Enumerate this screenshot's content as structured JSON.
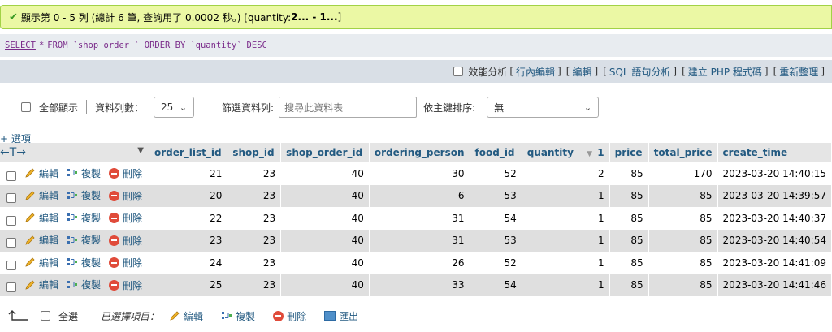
{
  "success": {
    "prefix": "顯示第 0 - 5 列 (總計 6 筆, 查詢用了 0.0002 秒。) [quantity: ",
    "bold": "2... - 1...",
    "suffix": "]"
  },
  "sql": {
    "select": "SELECT",
    "star": "*",
    "from": "FROM",
    "table": "`shop_order_`",
    "order_by": "ORDER BY",
    "column": "`quantity`",
    "desc": "DESC"
  },
  "tools": {
    "profiling": "效能分析",
    "inline_edit": "行內編輯",
    "edit": "編輯",
    "sql_analyze": "SQL 語句分析",
    "create_php": "建立 PHP 程式碼",
    "refresh": "重新整理"
  },
  "nav": {
    "show_all": "全部顯示",
    "rows_label": "資料列數：",
    "rows_value": "25",
    "filter_label": "篩選資料列:",
    "search_placeholder": "搜尋此資料表",
    "sort_label": "依主鍵排序:",
    "sort_value": "無"
  },
  "options_label": "+ 選項",
  "table": {
    "arrows": "←T→",
    "columns": [
      "order_list_id",
      "shop_id",
      "shop_order_id",
      "ordering_person",
      "food_id",
      "quantity",
      "price",
      "total_price",
      "create_time"
    ],
    "quantity_sort_index": "1",
    "action_labels": {
      "edit": "編輯",
      "copy": "複製",
      "delete": "刪除"
    },
    "rows": [
      [
        "21",
        "23",
        "40",
        "30",
        "52",
        "2",
        "85",
        "170",
        "2023-03-20 14:40:15"
      ],
      [
        "20",
        "23",
        "40",
        "6",
        "53",
        "1",
        "85",
        "85",
        "2023-03-20 14:39:57"
      ],
      [
        "22",
        "23",
        "40",
        "31",
        "54",
        "1",
        "85",
        "85",
        "2023-03-20 14:40:37"
      ],
      [
        "23",
        "23",
        "40",
        "31",
        "53",
        "1",
        "85",
        "85",
        "2023-03-20 14:40:54"
      ],
      [
        "24",
        "23",
        "40",
        "26",
        "52",
        "1",
        "85",
        "85",
        "2023-03-20 14:41:09"
      ],
      [
        "25",
        "23",
        "40",
        "33",
        "54",
        "1",
        "85",
        "85",
        "2023-03-20 14:41:46"
      ]
    ]
  },
  "bottom": {
    "select_all": "全選",
    "selected_items": "已選擇項目：",
    "edit": "編輯",
    "copy": "複製",
    "delete": "刪除",
    "export": "匯出"
  },
  "colors": {
    "success_bg": "#ebf8a4",
    "link": "#235a81",
    "delete": "#e04b3a"
  }
}
